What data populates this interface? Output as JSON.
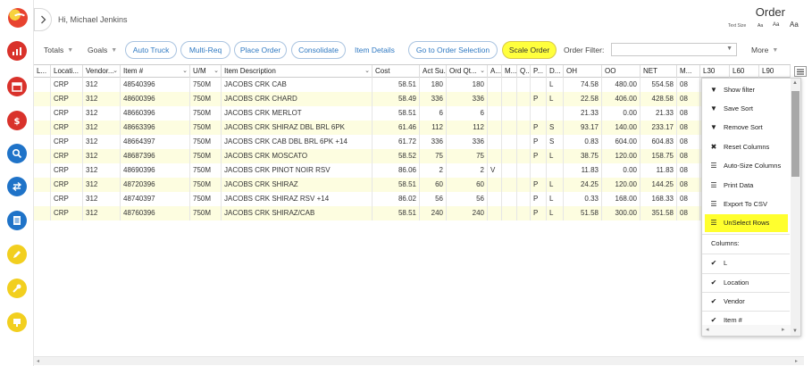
{
  "header": {
    "greeting": "Hi, Michael Jenkins",
    "page_title": "Order",
    "text_size_label": "Text Size",
    "text_size_options": [
      "Aa",
      "Aa",
      "Aa"
    ]
  },
  "rail": {
    "icons": [
      "dashboard-chart-icon",
      "calendar-icon",
      "dollar-icon",
      "search-icon",
      "transfer-icon",
      "document-icon",
      "pencil-icon",
      "wrench-icon",
      "hand-icon"
    ],
    "colors": [
      "#d9322b",
      "#d9322b",
      "#d9322b",
      "#1f73c8",
      "#1f73c8",
      "#1f73c8",
      "#f2cf1f",
      "#f2cf1f",
      "#f2cf1f"
    ]
  },
  "toolbar": {
    "totals": "Totals",
    "goals": "Goals",
    "auto_truck": "Auto Truck",
    "multi_req": "Multi-Req",
    "place_order": "Place Order",
    "consolidate": "Consolidate",
    "item_details": "Item Details",
    "go_to_order_selection": "Go to Order Selection",
    "scale_order": "Scale Order",
    "order_filter_label": "Order Filter:",
    "order_filter_value": "",
    "more": "More"
  },
  "grid": {
    "columns": [
      "L...",
      "Locati...",
      "Vendor...",
      "Item #",
      "U/M",
      "Item Description",
      "Cost",
      "Act Su...",
      "Ord Qt...",
      "A...",
      "M...",
      "Q...",
      "P...",
      "D...",
      "OH",
      "OO",
      "NET",
      "M...",
      "L30",
      "L60",
      "L90"
    ],
    "rows": [
      [
        "",
        "CRP",
        "312",
        "48540396",
        "750M",
        "JACOBS CRK CAB",
        "58.51",
        "180",
        "180",
        "",
        "",
        "",
        "",
        "L",
        "74.58",
        "480.00",
        "554.58",
        "08",
        "",
        "",
        ""
      ],
      [
        "",
        "CRP",
        "312",
        "48600396",
        "750M",
        "JACOBS CRK CHARD",
        "58.49",
        "336",
        "336",
        "",
        "",
        "",
        "P",
        "L",
        "22.58",
        "406.00",
        "428.58",
        "08",
        "",
        "",
        ""
      ],
      [
        "",
        "CRP",
        "312",
        "48660396",
        "750M",
        "JACOBS CRK MERLOT",
        "58.51",
        "6",
        "6",
        "",
        "",
        "",
        "",
        "",
        "21.33",
        "0.00",
        "21.33",
        "08",
        "",
        "",
        ""
      ],
      [
        "",
        "CRP",
        "312",
        "48663396",
        "750M",
        "JACOBS CRK SHIRAZ DBL BRL 6PK",
        "61.46",
        "112",
        "112",
        "",
        "",
        "",
        "P",
        "S",
        "93.17",
        "140.00",
        "233.17",
        "08",
        "",
        "",
        ""
      ],
      [
        "",
        "CRP",
        "312",
        "48664397",
        "750M",
        "JACOBS CRK CAB DBL BRL 6PK +14",
        "61.72",
        "336",
        "336",
        "",
        "",
        "",
        "P",
        "S",
        "0.83",
        "604.00",
        "604.83",
        "08",
        "",
        "",
        ""
      ],
      [
        "",
        "CRP",
        "312",
        "48687396",
        "750M",
        "JACOBS CRK MOSCATO",
        "58.52",
        "75",
        "75",
        "",
        "",
        "",
        "P",
        "L",
        "38.75",
        "120.00",
        "158.75",
        "08",
        "",
        "",
        ""
      ],
      [
        "",
        "CRP",
        "312",
        "48690396",
        "750M",
        "JACOBS CRK PINOT NOIR RSV",
        "86.06",
        "2",
        "2",
        "V",
        "",
        "",
        "",
        "",
        "11.83",
        "0.00",
        "11.83",
        "08",
        "",
        "",
        ""
      ],
      [
        "",
        "CRP",
        "312",
        "48720396",
        "750M",
        "JACOBS CRK SHIRAZ",
        "58.51",
        "60",
        "60",
        "",
        "",
        "",
        "P",
        "L",
        "24.25",
        "120.00",
        "144.25",
        "08",
        "",
        "",
        ""
      ],
      [
        "",
        "CRP",
        "312",
        "48740397",
        "750M",
        "JACOBS CRK SHIRAZ RSV +14",
        "86.02",
        "56",
        "56",
        "",
        "",
        "",
        "P",
        "L",
        "0.33",
        "168.00",
        "168.33",
        "08",
        "",
        "",
        ""
      ],
      [
        "",
        "CRP",
        "312",
        "48760396",
        "750M",
        "JACOBS CRK SHIRAZ/CAB",
        "58.51",
        "240",
        "240",
        "",
        "",
        "",
        "P",
        "L",
        "51.58",
        "300.00",
        "351.58",
        "08",
        "",
        "",
        ""
      ]
    ]
  },
  "column_menu": {
    "items": [
      {
        "icon": "filter-icon",
        "label": "Show filter"
      },
      {
        "icon": "filter-icon",
        "label": "Save Sort"
      },
      {
        "icon": "filter-icon",
        "label": "Remove Sort"
      },
      {
        "icon": "close-x-icon",
        "label": "Reset Columns"
      },
      {
        "icon": "list-icon",
        "label": "Auto-Size Columns"
      },
      {
        "icon": "list-icon",
        "label": "Print Data"
      },
      {
        "icon": "list-icon",
        "label": "Export To CSV"
      },
      {
        "icon": "list-icon",
        "label": "UnSelect Rows"
      }
    ],
    "columns_heading": "Columns:",
    "column_toggles": [
      "L",
      "Location",
      "Vendor",
      "Item #"
    ]
  }
}
